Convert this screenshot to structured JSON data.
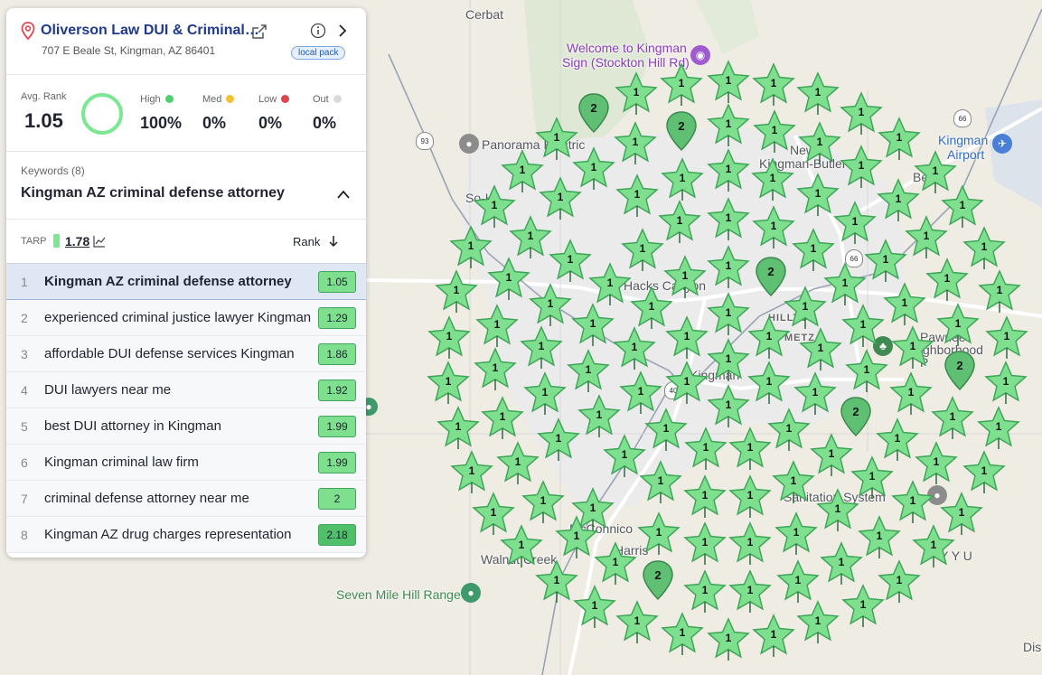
{
  "panel": {
    "business_name": "Oliverson Law DUI & Criminal…",
    "address": "707 E Beale St, Kingman, AZ 86401",
    "badge": "local pack",
    "avg_rank_label": "Avg. Rank",
    "avg_rank": "1.05",
    "buckets": [
      {
        "label": "High",
        "value": "100%",
        "color": "#4cd26b"
      },
      {
        "label": "Med",
        "value": "0%",
        "color": "#f2c234"
      },
      {
        "label": "Low",
        "value": "0%",
        "color": "#e0444d"
      },
      {
        "label": "Out",
        "value": "0%",
        "color": "#dadada"
      }
    ],
    "keywords_label": "Keywords (8)",
    "selected_keyword": "Kingman AZ criminal defense attorney",
    "tarp_label": "TARP",
    "tarp_value": "1.78",
    "rank_label": "Rank",
    "keywords": [
      {
        "n": "1",
        "text": "Kingman AZ criminal defense attorney",
        "rank": "1.05"
      },
      {
        "n": "2",
        "text": "experienced criminal justice lawyer Kingman",
        "rank": "1.29"
      },
      {
        "n": "3",
        "text": "affordable DUI defense services Kingman",
        "rank": "1.86"
      },
      {
        "n": "4",
        "text": "DUI lawyers near me",
        "rank": "1.92"
      },
      {
        "n": "5",
        "text": "best DUI attorney in Kingman",
        "rank": "1.99"
      },
      {
        "n": "6",
        "text": "Kingman criminal law firm",
        "rank": "1.99"
      },
      {
        "n": "7",
        "text": "criminal defense attorney near me",
        "rank": "2"
      },
      {
        "n": "8",
        "text": "Kingman AZ drug charges representation",
        "rank": "2.18"
      }
    ]
  },
  "map": {
    "labels": {
      "cerbat": "Cerbat",
      "welcome": "Welcome to Kingman",
      "welcome2": "Sign (Stockton Hill Rd)",
      "panorama": "Panorama Electric",
      "kingman_airport": "Kingman",
      "kingman_airport2": "Airport",
      "new_kingman": "New",
      "new_kingman2": "Kingman-Butler",
      "so_hi": "So-Hi",
      "be": "Be",
      "hackscamp": "Hacks Canyon",
      "hilltop": "HILLTOP",
      "metz": "METZ",
      "kingman": "Kingman",
      "pawnee": "Pawnee",
      "pawnee2": "Neighborhood",
      "pawnee3": "P",
      "sanitation": "Sanitation System",
      "mcconnico": "McConnico",
      "harris": "Harris",
      "walnut": "Walnut Creek",
      "seven_mile": "Seven Mile Hill Range",
      "yyu": "Y Y U",
      "dis": "Dis"
    },
    "shields": [
      "93",
      "66",
      "66",
      "40"
    ],
    "rank_marker_default": "1",
    "rank_marker_alt": "2"
  }
}
